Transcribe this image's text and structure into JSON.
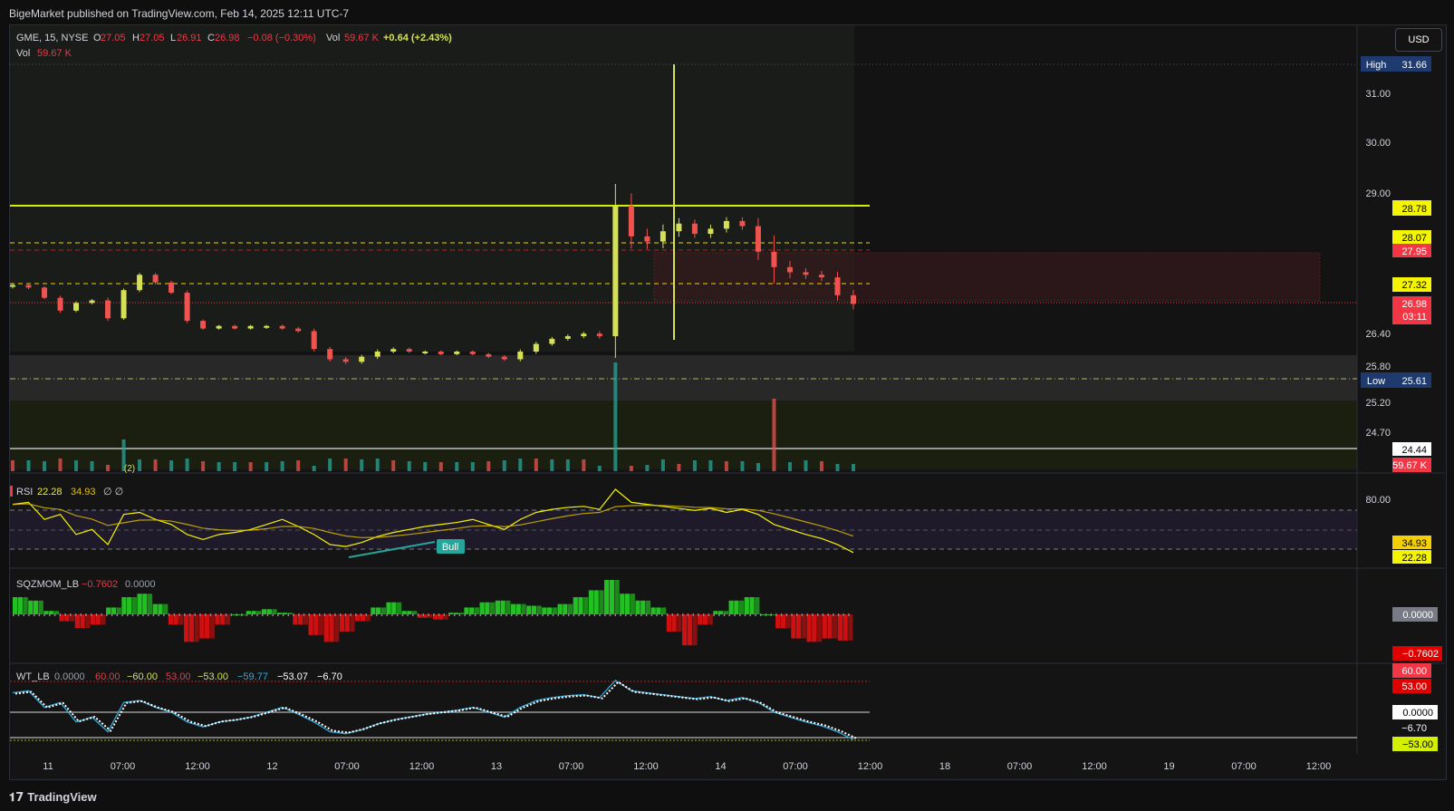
{
  "header": {
    "published": "BigeMarket published on TradingView.com, Feb 14, 2025 12:11 UTC-7"
  },
  "footer": {
    "brand": "TradingView"
  },
  "currency": "USD",
  "legend": {
    "symbol": "GME, 15, NYSE",
    "o_label": "O",
    "o": "27.05",
    "h_label": "H",
    "h": "27.05",
    "l_label": "L",
    "l": "26.91",
    "c_label": "C",
    "c": "26.98",
    "change": "−0.08 (−0.30%)",
    "vol_label": "Vol",
    "vol": "59.67 K",
    "extra": "+0.64 (+2.43%)",
    "vol2_label": "Vol",
    "vol2": "59.67 K"
  },
  "pane_labels": {
    "rsi": {
      "name": "RSI",
      "v1": "22.28",
      "v2": "34.93",
      "v3": "∅ ∅"
    },
    "sqz": {
      "name": "SQZMOM_LB",
      "v1": "−0.7602",
      "v2": "0.0000"
    },
    "wt": {
      "name": "WT_LB",
      "values": [
        "0.0000",
        "60.00",
        "−60.00",
        "53.00",
        "−53.00",
        "−59.77",
        "−53.07",
        "−6.70"
      ]
    }
  },
  "badges": {
    "high_label": "High",
    "high": "31.66",
    "low_label": "Low",
    "low": "25.61",
    "b2878": "28.78",
    "b2807": "28.07",
    "b2795": "27.95",
    "b2732": "27.32",
    "b2698": "26.98",
    "countdown": "03:11",
    "b2444": "24.44",
    "vol": "59.67 K",
    "rsi1": "34.93",
    "rsi2": "22.28",
    "sqz0": "0.0000",
    "sqz1": "−0.7602",
    "wt60": "60.00",
    "wt53": "53.00",
    "wt0": "0.0000",
    "wt670": "−6.70",
    "wtm53": "−53.00"
  },
  "annotations": {
    "bull": "Bull",
    "marker": "(2)"
  },
  "colors": {
    "up": "#26a69a",
    "down": "#ef5350",
    "candle_up": "#d4e157",
    "yellow": "#f5f500",
    "red": "#f23645",
    "navy": "#1e3a6e",
    "rsi_line": "#f5f500",
    "rsi_ma": "#e0c000"
  },
  "chart_data": {
    "type": "candlestick",
    "price_axis": [
      "31.00",
      "30.00",
      "29.00",
      "26.40",
      "25.80",
      "25.20",
      "24.70"
    ],
    "rsi_axis": [
      "80.00"
    ],
    "time_axis": [
      "11",
      "07:00",
      "12:00",
      "12",
      "07:00",
      "12:00",
      "13",
      "07:00",
      "12:00",
      "14",
      "07:00",
      "12:00",
      "18",
      "07:00",
      "12:00",
      "19",
      "07:00",
      "12:00"
    ],
    "ylim": [
      24.2,
      31.9
    ],
    "key_levels": {
      "high": 31.66,
      "low": 25.61,
      "resistance": 28.78,
      "dashed_upper": 28.07,
      "dashed_red": 27.95,
      "dashed_lower": 27.32,
      "last": 26.98,
      "support": 24.44
    },
    "price_path": [
      [
        27.35,
        6
      ],
      [
        27.3,
        6
      ],
      [
        27.1,
        5
      ],
      [
        26.85,
        8
      ],
      [
        27.0,
        6
      ],
      [
        27.05,
        5
      ],
      [
        26.7,
        10
      ],
      [
        27.25,
        6
      ],
      [
        27.55,
        7
      ],
      [
        27.4,
        7
      ],
      [
        27.2,
        6
      ],
      [
        26.65,
        8
      ],
      [
        26.5,
        5
      ],
      [
        26.55,
        4
      ],
      [
        26.5,
        4
      ],
      [
        26.55,
        4
      ],
      [
        26.55,
        4
      ],
      [
        26.5,
        5
      ],
      [
        26.45,
        6
      ],
      [
        26.1,
        9
      ],
      [
        25.9,
        8
      ],
      [
        25.85,
        8
      ],
      [
        25.95,
        7
      ],
      [
        26.05,
        8
      ],
      [
        26.1,
        6
      ],
      [
        26.05,
        5
      ],
      [
        26.05,
        4
      ],
      [
        26.0,
        4
      ],
      [
        26.05,
        4
      ],
      [
        26.0,
        4
      ],
      [
        25.95,
        5
      ],
      [
        25.9,
        6
      ],
      [
        26.05,
        8
      ],
      [
        26.2,
        8
      ],
      [
        26.3,
        7
      ],
      [
        26.35,
        7
      ],
      [
        26.4,
        7
      ],
      [
        26.35,
        9
      ],
      [
        28.9,
        80
      ],
      [
        28.3,
        45
      ],
      [
        28.2,
        28
      ],
      [
        28.4,
        25
      ],
      [
        28.55,
        20
      ],
      [
        28.35,
        15
      ],
      [
        28.45,
        15
      ],
      [
        28.6,
        14
      ],
      [
        28.5,
        14
      ],
      [
        28.0,
        30
      ],
      [
        27.7,
        60
      ],
      [
        27.6,
        22
      ],
      [
        27.55,
        15
      ],
      [
        27.5,
        14
      ],
      [
        27.15,
        20
      ],
      [
        26.98,
        20
      ]
    ],
    "rsi": [
      70,
      72,
      55,
      60,
      40,
      45,
      30,
      60,
      62,
      55,
      50,
      40,
      35,
      40,
      42,
      45,
      50,
      55,
      48,
      40,
      30,
      28,
      32,
      38,
      42,
      45,
      48,
      50,
      52,
      55,
      50,
      45,
      55,
      62,
      65,
      67,
      68,
      65,
      85,
      72,
      70,
      68,
      66,
      64,
      66,
      62,
      65,
      60,
      50,
      45,
      40,
      36,
      30,
      22
    ],
    "sqz": [
      0.5,
      0.4,
      0.1,
      -0.2,
      -0.4,
      -0.3,
      0.2,
      0.5,
      0.6,
      0.3,
      -0.3,
      -0.8,
      -0.7,
      -0.3,
      0.0,
      0.1,
      0.15,
      0.05,
      -0.3,
      -0.6,
      -0.8,
      -0.5,
      -0.2,
      0.2,
      0.35,
      0.1,
      -0.1,
      -0.15,
      0.05,
      0.2,
      0.35,
      0.4,
      0.3,
      0.25,
      0.2,
      0.3,
      0.5,
      0.7,
      1.0,
      0.6,
      0.4,
      0.2,
      -0.5,
      -0.9,
      -0.3,
      0.1,
      0.4,
      0.5,
      0.0,
      -0.4,
      -0.7,
      -0.8,
      -0.7,
      -0.76
    ]
  }
}
